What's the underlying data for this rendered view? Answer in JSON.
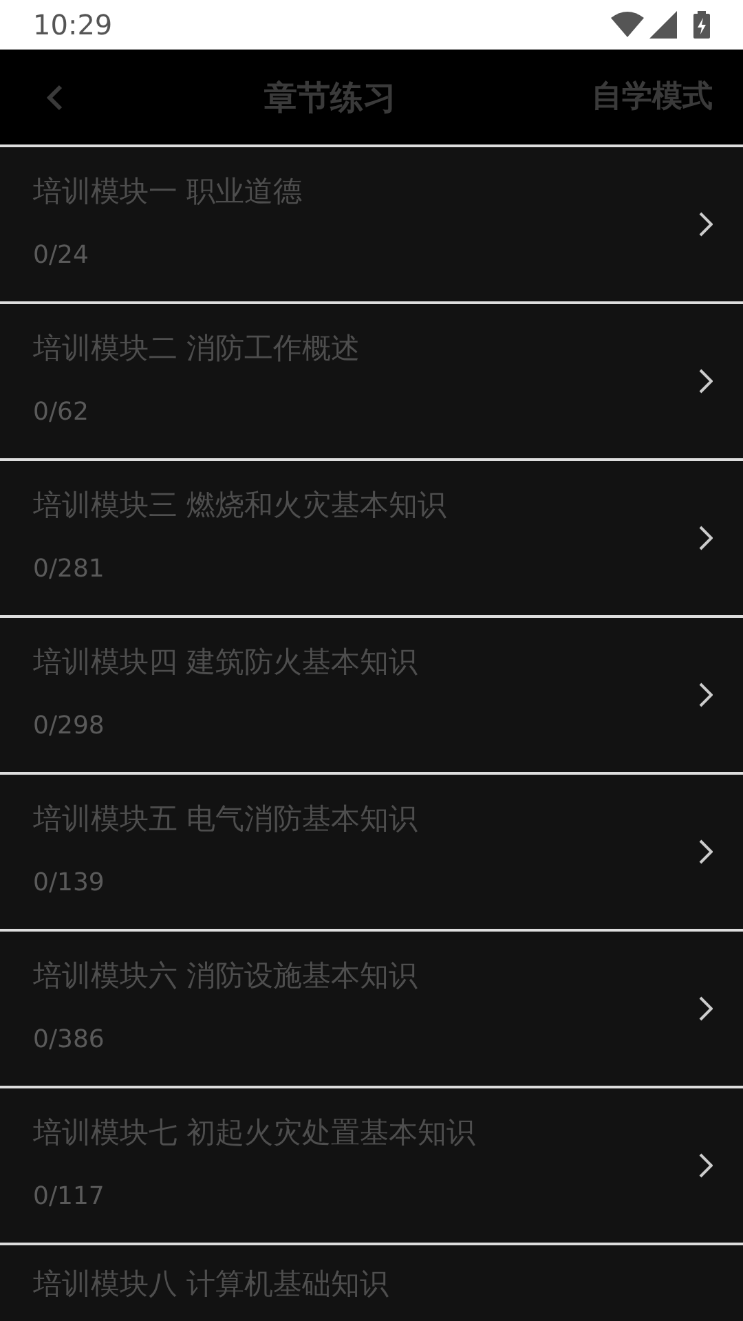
{
  "status_bar": {
    "time": "10:29"
  },
  "header": {
    "title": "章节练习",
    "action": "自学模式"
  },
  "chapters": [
    {
      "title": "培训模块一 职业道德",
      "count": "0/24"
    },
    {
      "title": "培训模块二 消防工作概述",
      "count": "0/62"
    },
    {
      "title": "培训模块三 燃烧和火灾基本知识",
      "count": "0/281"
    },
    {
      "title": "培训模块四 建筑防火基本知识",
      "count": "0/298"
    },
    {
      "title": "培训模块五 电气消防基本知识",
      "count": "0/139"
    },
    {
      "title": "培训模块六 消防设施基本知识",
      "count": "0/386"
    },
    {
      "title": "培训模块七 初起火灾处置基本知识",
      "count": "0/117"
    },
    {
      "title": "培训模块八 计算机基础知识"
    }
  ]
}
